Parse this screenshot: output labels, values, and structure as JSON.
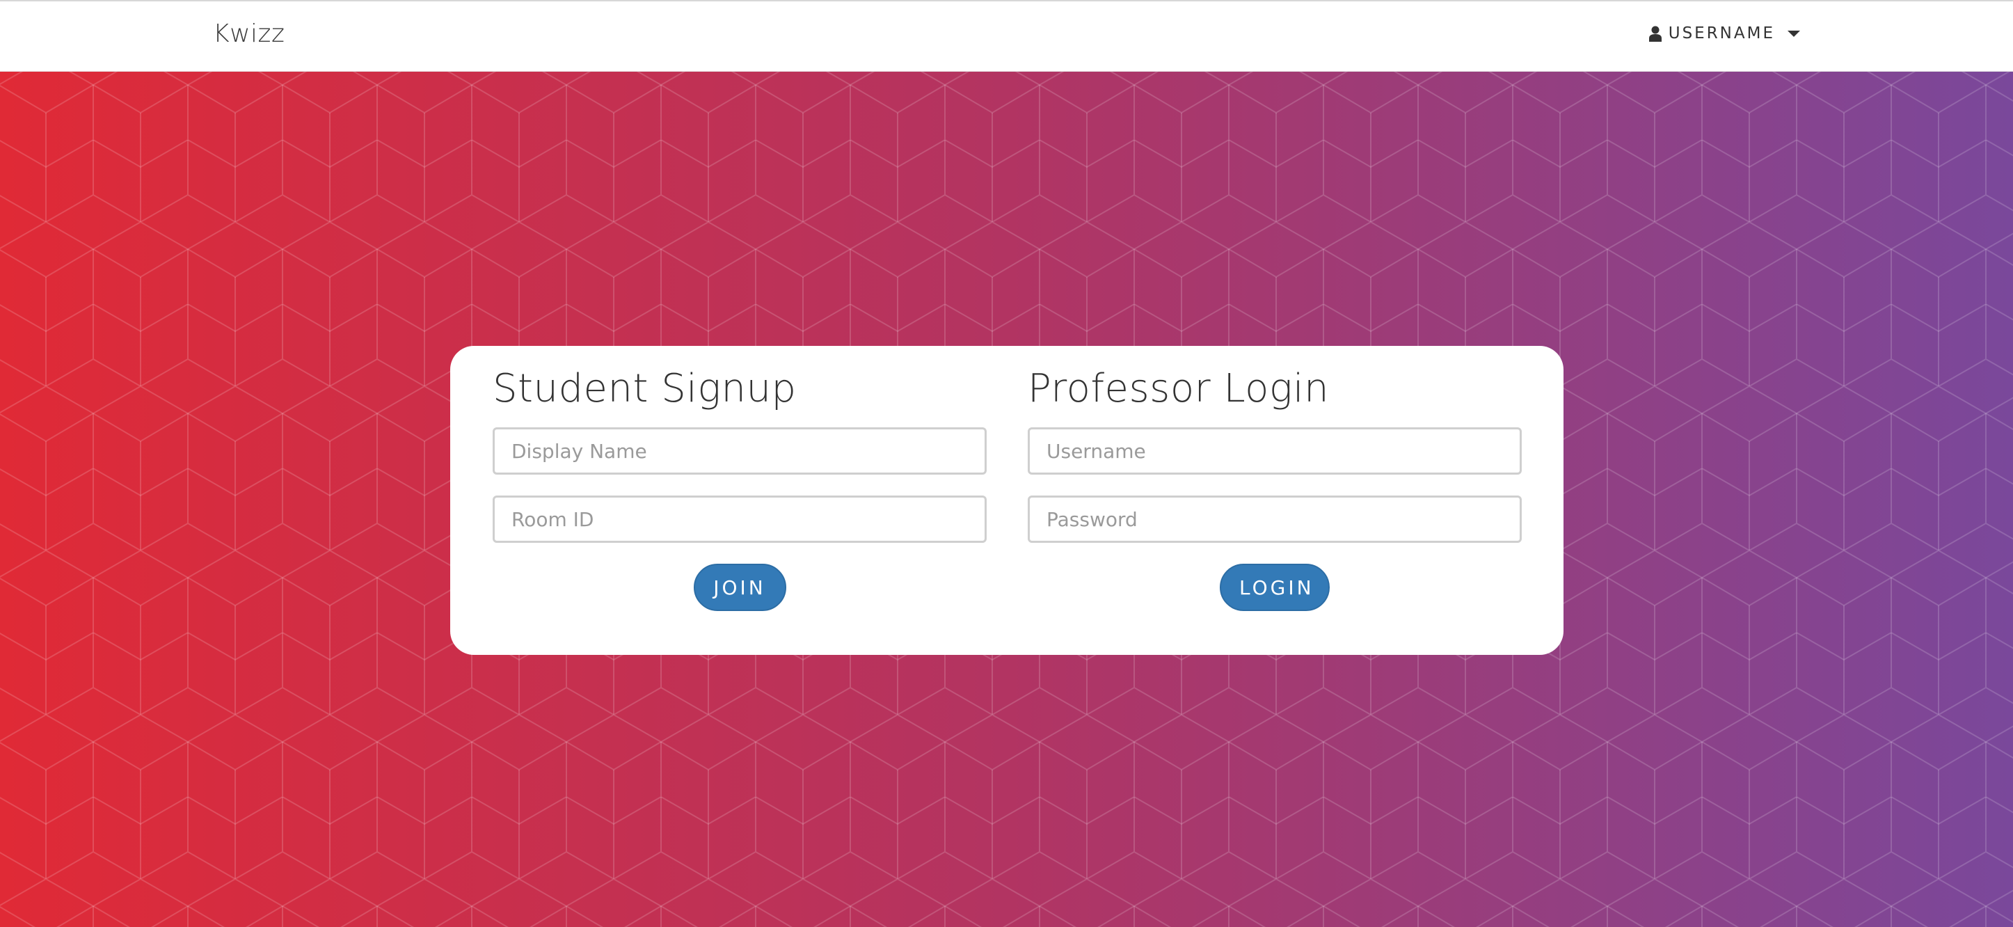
{
  "navbar": {
    "brand": "Kwizz",
    "user_menu_label": "USERNAME",
    "user_icon": "user-icon",
    "caret_icon": "caret-down-icon"
  },
  "student_signup": {
    "title": "Student Signup",
    "display_name_placeholder": "Display Name",
    "room_id_placeholder": "Room ID",
    "join_label": "JOIN"
  },
  "professor_login": {
    "title": "Professor Login",
    "username_placeholder": "Username",
    "password_placeholder": "Password",
    "login_label": "LOGIN"
  },
  "colors": {
    "gradient_start": "#e02a36",
    "gradient_end": "#7a489b",
    "button": "#337ab7",
    "card": "#ffffff"
  }
}
